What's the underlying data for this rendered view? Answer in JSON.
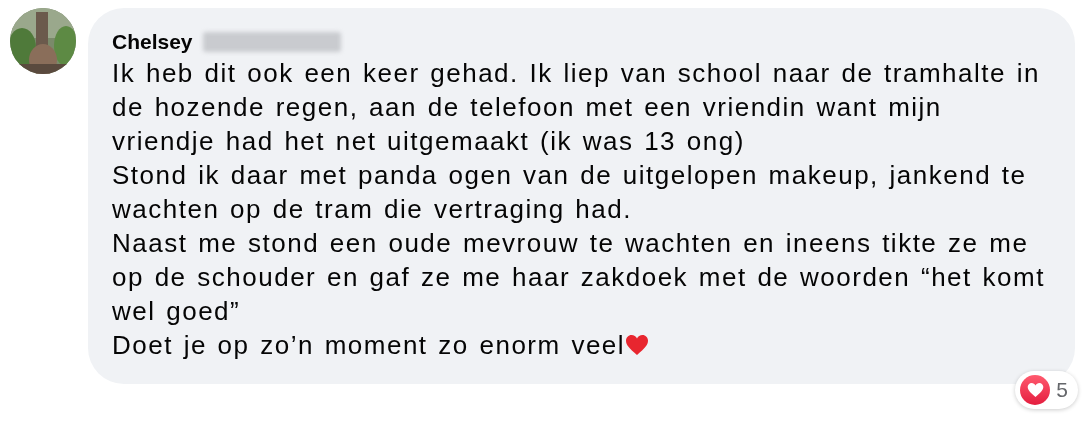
{
  "comment": {
    "author": "Chelsey",
    "author_surname_redacted": true,
    "paragraphs": [
      "Ik heb dit ook een keer gehad. Ik liep van school naar de tramhalte in de hozende regen, aan de telefoon met een vriendin want mijn vriendje had het net uitgemaakt (ik was 13 ong)",
      "Stond ik daar met panda ogen van de uitgelopen makeup, jankend te wachten op de tram die vertraging had.",
      "Naast me stond een oude mevrouw te wachten en ineens tikte ze me op de schouder en gaf ze me haar zakdoek met de woorden “het komt wel goed”",
      "Doet je op zo’n moment zo enorm veel"
    ],
    "ends_with_heart": true,
    "reactions": {
      "count": "5"
    }
  }
}
